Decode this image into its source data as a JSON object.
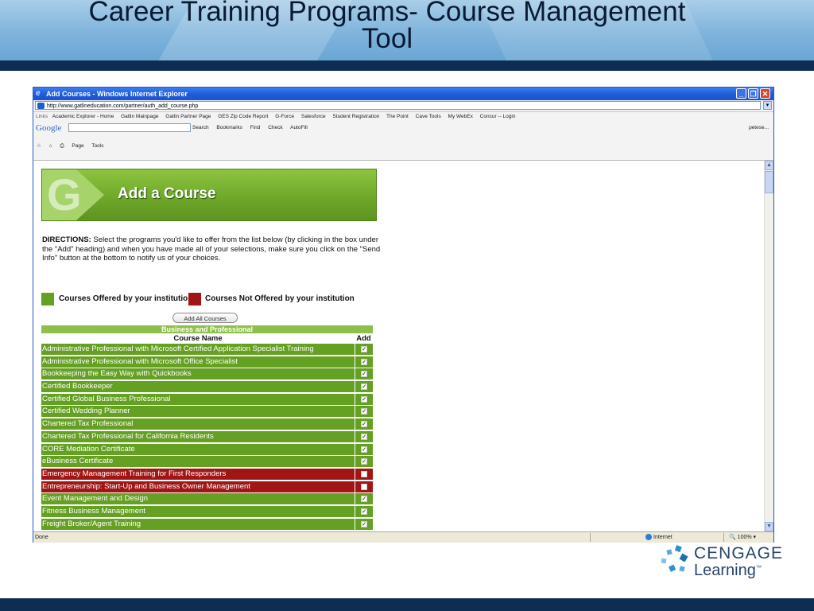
{
  "slide": {
    "title_line1": "Career Training Programs- Course Management",
    "title_line2": "Tool"
  },
  "browser": {
    "window_title": "Add Courses - Windows Internet Explorer",
    "address": "http://www.gatlineducation.com/partner/auth_add_course.php",
    "links_label": "Links",
    "links": [
      "Academic Explorer - Home",
      "Gatlin Mainpage",
      "Gatlin Partner Page",
      "GES Zip Code Report",
      "G-Force",
      "Salesforce",
      "Student Registration",
      "The Point",
      "Cave Tools",
      "My WebEx",
      "Concur -- Login"
    ],
    "google_logo": "Google",
    "google_items": [
      "Search",
      "Bookmarks",
      "Find",
      "Check",
      "AutoFill"
    ],
    "google_user": "petese...",
    "command_items": [
      "Page",
      "Tools"
    ],
    "status_text": "Done",
    "zone": "Internet",
    "zoom": "100%"
  },
  "page": {
    "banner_title": "Add a Course",
    "banner_letter": "G",
    "directions_label": "DIRECTIONS:",
    "directions_text": " Select the programs you'd like to offer from the list below (by clicking in the box under the \"Add\" heading) and when you have made all of your selections, make sure you click on the \"Send Info\" button at the bottom to notify us of your choices.",
    "legend_offered": "Courses Offered by your institution",
    "legend_not_offered": "Courses Not Offered by your institution",
    "add_all_label": "Add All Courses",
    "category": "Business and Professional",
    "col_course_name": "Course Name",
    "col_add": "Add",
    "colors": {
      "offered": "#64a021",
      "not_offered": "#a11515"
    },
    "courses": [
      {
        "name": "Administrative Professional with Microsoft Certified Application Specialist Training",
        "offered": true
      },
      {
        "name": "Administrative Professional with Microsoft Office Specialist",
        "offered": true
      },
      {
        "name": "Bookkeeping the Easy Way with Quickbooks",
        "offered": true
      },
      {
        "name": "Certified Bookkeeper",
        "offered": true
      },
      {
        "name": "Certified Global Business Professional",
        "offered": true
      },
      {
        "name": "Certified Wedding Planner",
        "offered": true
      },
      {
        "name": "Chartered Tax Professional",
        "offered": true
      },
      {
        "name": "Chartered Tax Professional for California Residents",
        "offered": true
      },
      {
        "name": "CORE Mediation Certificate",
        "offered": true
      },
      {
        "name": "eBusiness Certificate",
        "offered": true
      },
      {
        "name": "Emergency Management Training for First Responders",
        "offered": false
      },
      {
        "name": "Entrepreneurship: Start-Up and Business Owner Management",
        "offered": false
      },
      {
        "name": "Event Management and Design",
        "offered": true
      },
      {
        "name": "Fitness Business Management",
        "offered": true
      },
      {
        "name": "Freight Broker/Agent Training",
        "offered": true
      }
    ]
  },
  "logo": {
    "line1": "CENGAGE",
    "line2": "Learning",
    "tm": "™"
  }
}
